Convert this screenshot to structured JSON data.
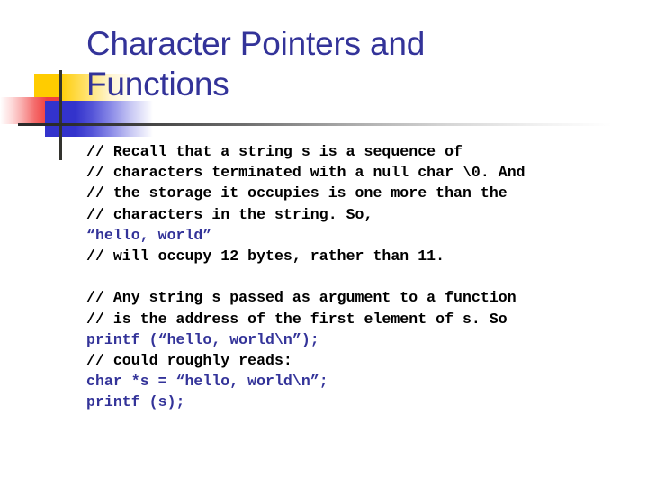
{
  "slide": {
    "title": "Character Pointers and\nFunctions",
    "title_color": "#333399",
    "background_color": "#ffffff",
    "comment_color": "#000000",
    "code_color": "#333399"
  },
  "decoration": {
    "yellow_color": "#ffcc00",
    "red_color": "#f04040",
    "blue_color": "#3333cc",
    "rule_color": "#2b2b2b"
  },
  "body": {
    "lines": [
      {
        "kind": "comment",
        "text": "// Recall that a string s is a sequence of"
      },
      {
        "kind": "comment",
        "text": "// characters terminated with a null char \\0. And"
      },
      {
        "kind": "comment",
        "text": "// the storage it occupies is one more than the"
      },
      {
        "kind": "comment",
        "text": "// characters in the string. So,"
      },
      {
        "kind": "code",
        "text": "“hello, world”"
      },
      {
        "kind": "comment",
        "text": "// will occupy 12 bytes, rather than 11."
      },
      {
        "kind": "spacer",
        "text": ""
      },
      {
        "kind": "comment",
        "text": "// Any string s passed as argument to a function"
      },
      {
        "kind": "comment",
        "text": "// is the address of the first element of s. So"
      },
      {
        "kind": "code",
        "text": "printf (“hello, world\\n”);"
      },
      {
        "kind": "comment",
        "text": "// could roughly reads:"
      },
      {
        "kind": "code",
        "text": "char *s = “hello, world\\n”;"
      },
      {
        "kind": "code",
        "text": "printf (s);"
      }
    ]
  }
}
